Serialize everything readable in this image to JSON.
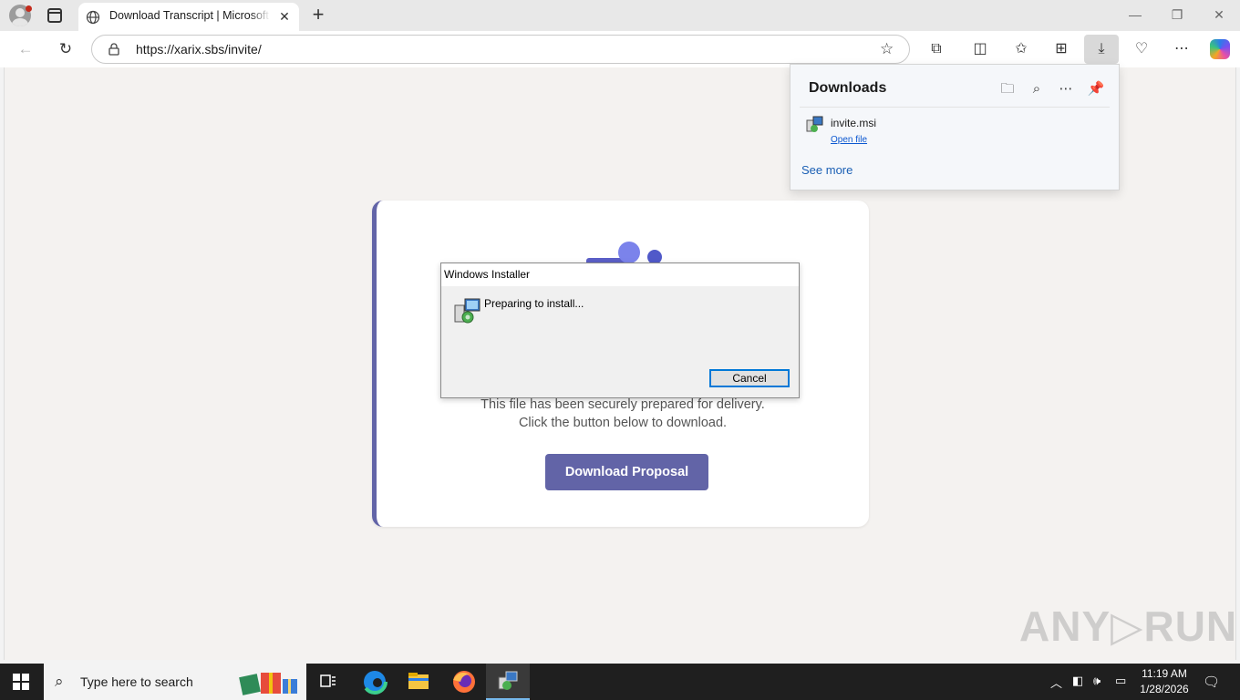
{
  "browser": {
    "tab_title": "Download Transcript | Microsoft Teams",
    "tab_close": "✕",
    "new_tab": "+",
    "url": "https://xarix.sbs/invite/",
    "window_controls": {
      "minimize": "—",
      "restore": "❐",
      "close": "✕"
    }
  },
  "page": {
    "message_line1": "This file has been securely prepared for delivery.",
    "message_line2": "Click the button below to download.",
    "download_button": "Download Proposal",
    "colors": {
      "accent": "#6264a7",
      "background": "#f4f2f0"
    }
  },
  "installer_dialog": {
    "title": "Windows Installer",
    "status": "Preparing to install...",
    "cancel_label": "Cancel"
  },
  "downloads_panel": {
    "title": "Downloads",
    "file_name": "invite.msi",
    "open_file": "Open file",
    "see_more": "See more"
  },
  "watermark": "ANY▷RUN",
  "taskbar": {
    "search_placeholder": "Type here to search",
    "time": "11:19 AM",
    "date": "1/28/2026"
  }
}
